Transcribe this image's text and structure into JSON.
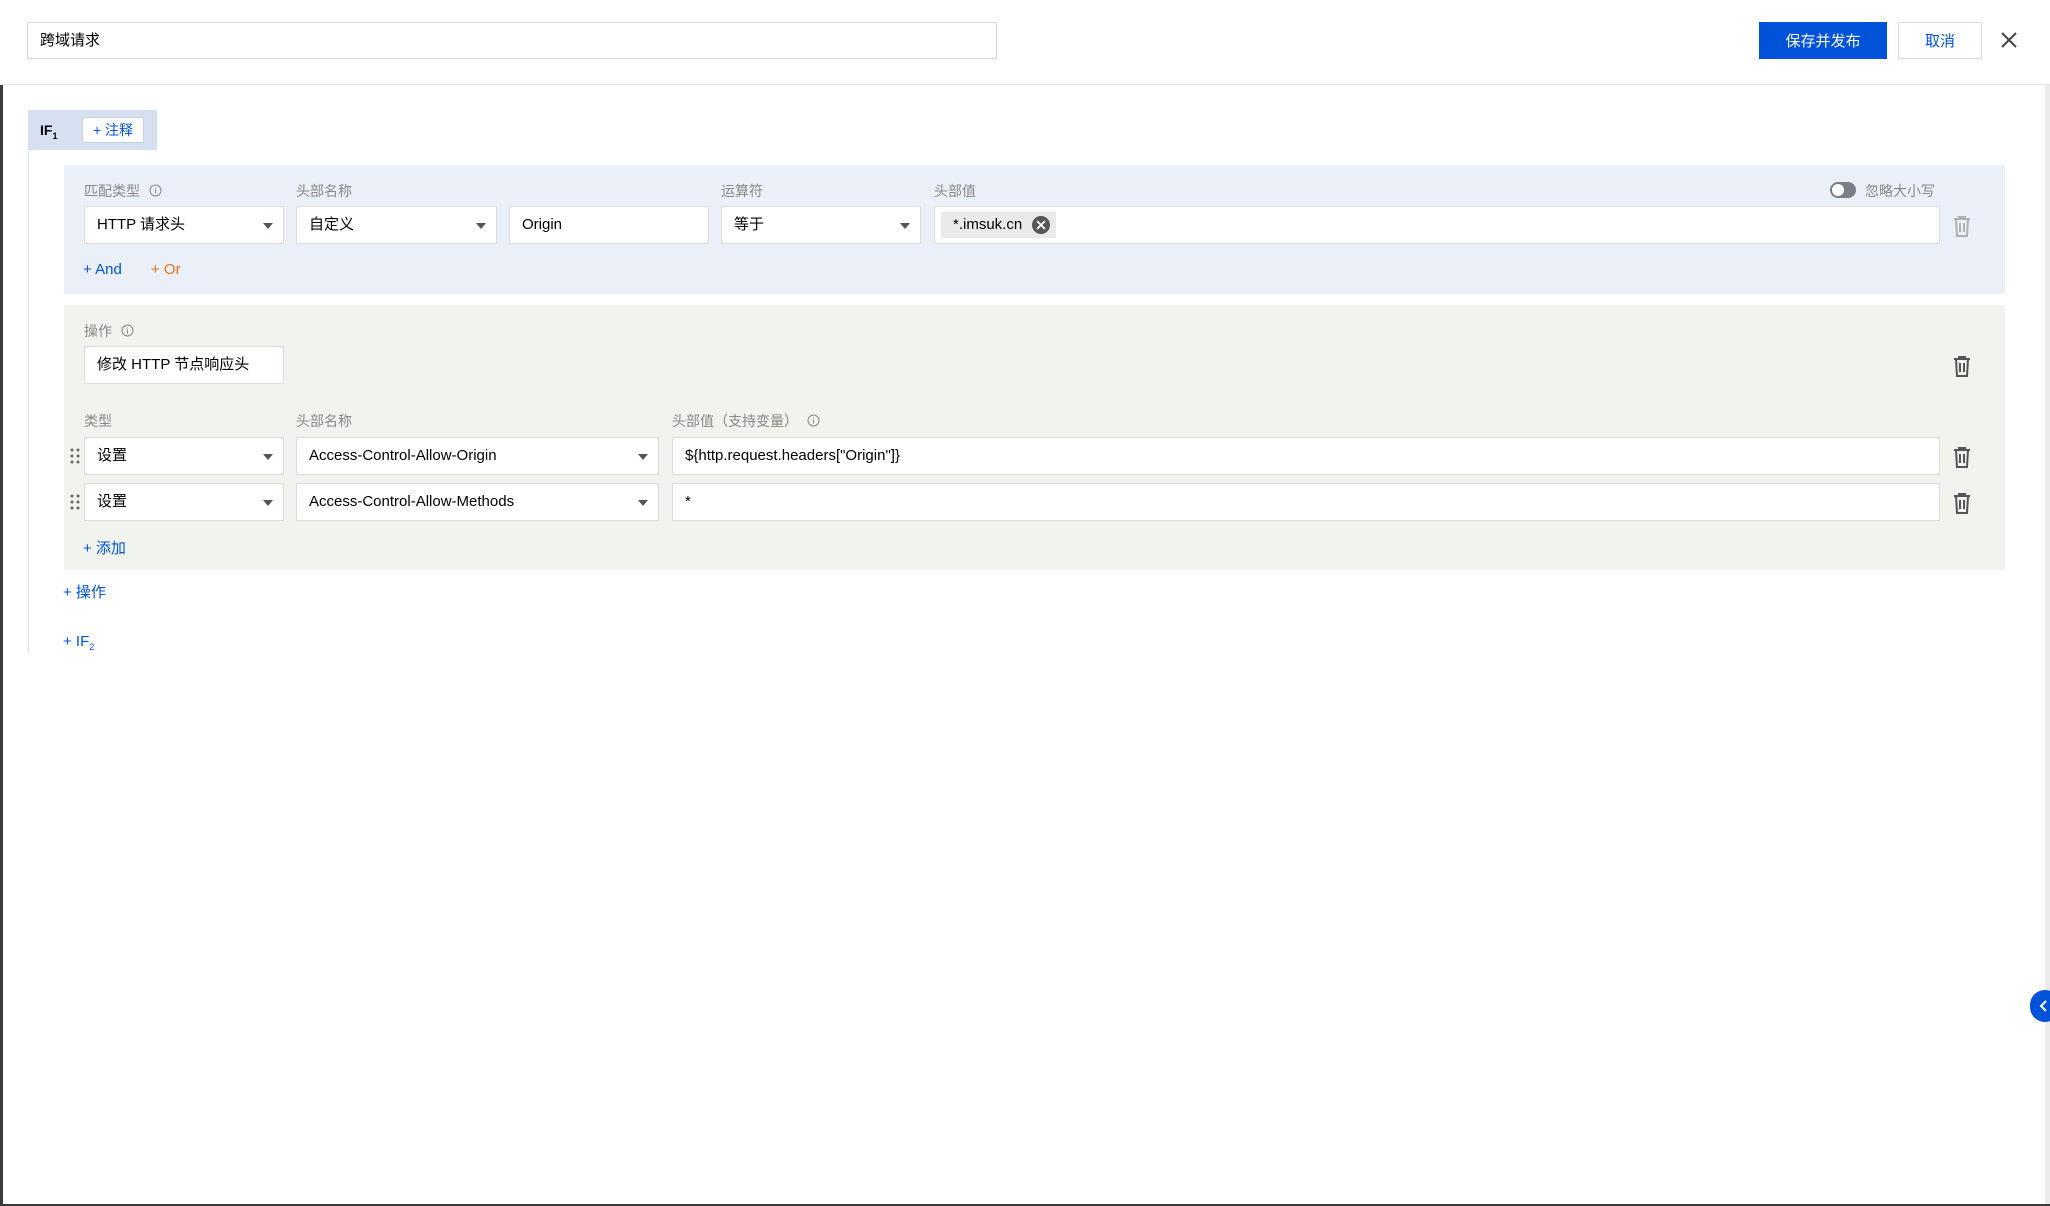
{
  "header": {
    "rule_name": "跨域请求",
    "save_publish_label": "保存并发布",
    "cancel_label": "取消"
  },
  "rule": {
    "if_label": "IF",
    "if_index": "1",
    "note_button_label": "+ 注释",
    "condition": {
      "match_type_label": "匹配类型",
      "header_name_label": "头部名称",
      "operator_label": "运算符",
      "header_value_label": "头部值",
      "ignore_case_label": "忽略大小写",
      "ignore_case_enabled": false,
      "match_type_value": "HTTP 请求头",
      "header_name_value": "自定义",
      "custom_header_value": "Origin",
      "operator_value": "等于",
      "header_value_tags": [
        "*.imsuk.cn"
      ],
      "and_label": "+ And",
      "or_label": "+ Or"
    },
    "operation": {
      "action_label": "操作",
      "action_value": "修改 HTTP 节点响应头",
      "type_col_label": "类型",
      "header_name_col_label": "头部名称",
      "header_value_col_label": "头部值（支持变量）",
      "rows": [
        {
          "type": "设置",
          "name": "Access-Control-Allow-Origin",
          "value": "${http.request.headers[\"Origin\"]}"
        },
        {
          "type": "设置",
          "name": "Access-Control-Allow-Methods",
          "value": "*"
        }
      ],
      "add_label": "+ 添加"
    },
    "add_operation_label": "+ 操作"
  },
  "add_if": {
    "label": "+ IF",
    "index": "2"
  },
  "colors": {
    "primary": "#0052d9",
    "or_accent": "#e37318",
    "condition_bg": "#ebeff7",
    "operation_bg": "#f0f3ee",
    "if_tab_bg": "#d6e0f1"
  },
  "icons": [
    "close-icon",
    "info-icon",
    "caret-down-icon",
    "tag-close-icon",
    "trash-icon",
    "drag-handle-icon",
    "chevron-left-icon"
  ]
}
